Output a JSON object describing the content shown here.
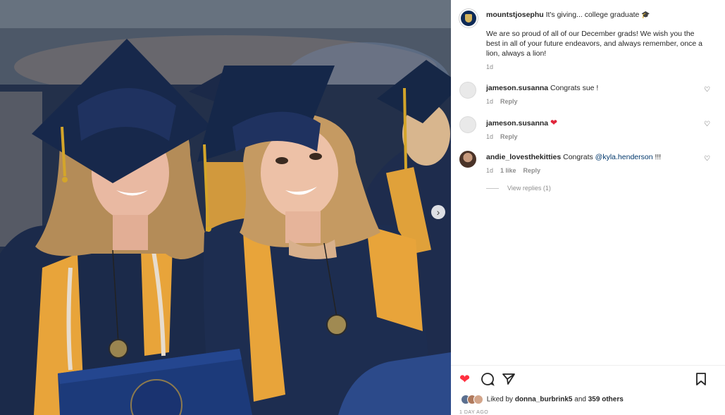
{
  "post": {
    "username": "mountstjosephu",
    "caption_line": " It's giving... college graduate",
    "caption_body": "We are so proud of all of our December grads! We wish you the best in all of your future endeavors, and always remember, once a lion, always a lion!",
    "time": "1d",
    "caption_emoji_icon": "graduation-cap-emoji"
  },
  "comments": [
    {
      "username": "jameson.susanna",
      "text": " Congrats sue !",
      "time": "1d",
      "likes": "",
      "reply": "Reply",
      "emoji": ""
    },
    {
      "username": "jameson.susanna",
      "text": " ",
      "time": "1d",
      "likes": "",
      "reply": "Reply",
      "emoji": "❤"
    },
    {
      "username": "andie_lovesthekitties",
      "text": " Congrats ",
      "mention": "@kyla.henderson",
      "tail": " !!!",
      "time": "1d",
      "likes": "1 like",
      "reply": "Reply",
      "emoji": ""
    }
  ],
  "view_replies": "View replies (1)",
  "likes": {
    "prefix": "Liked by ",
    "user": "donna_burbrink5",
    "middle": " and ",
    "others": "359 others"
  },
  "posted_ago": "1 DAY AGO",
  "colors": {
    "heart": "#ff3040",
    "link": "#00376b",
    "muted": "#8e8e8e",
    "gown": "#1b2a4a",
    "stole": "#e8a43a"
  },
  "icons": [
    "heart-icon",
    "comment-icon",
    "share-icon",
    "bookmark-icon",
    "chevron-right-icon"
  ]
}
